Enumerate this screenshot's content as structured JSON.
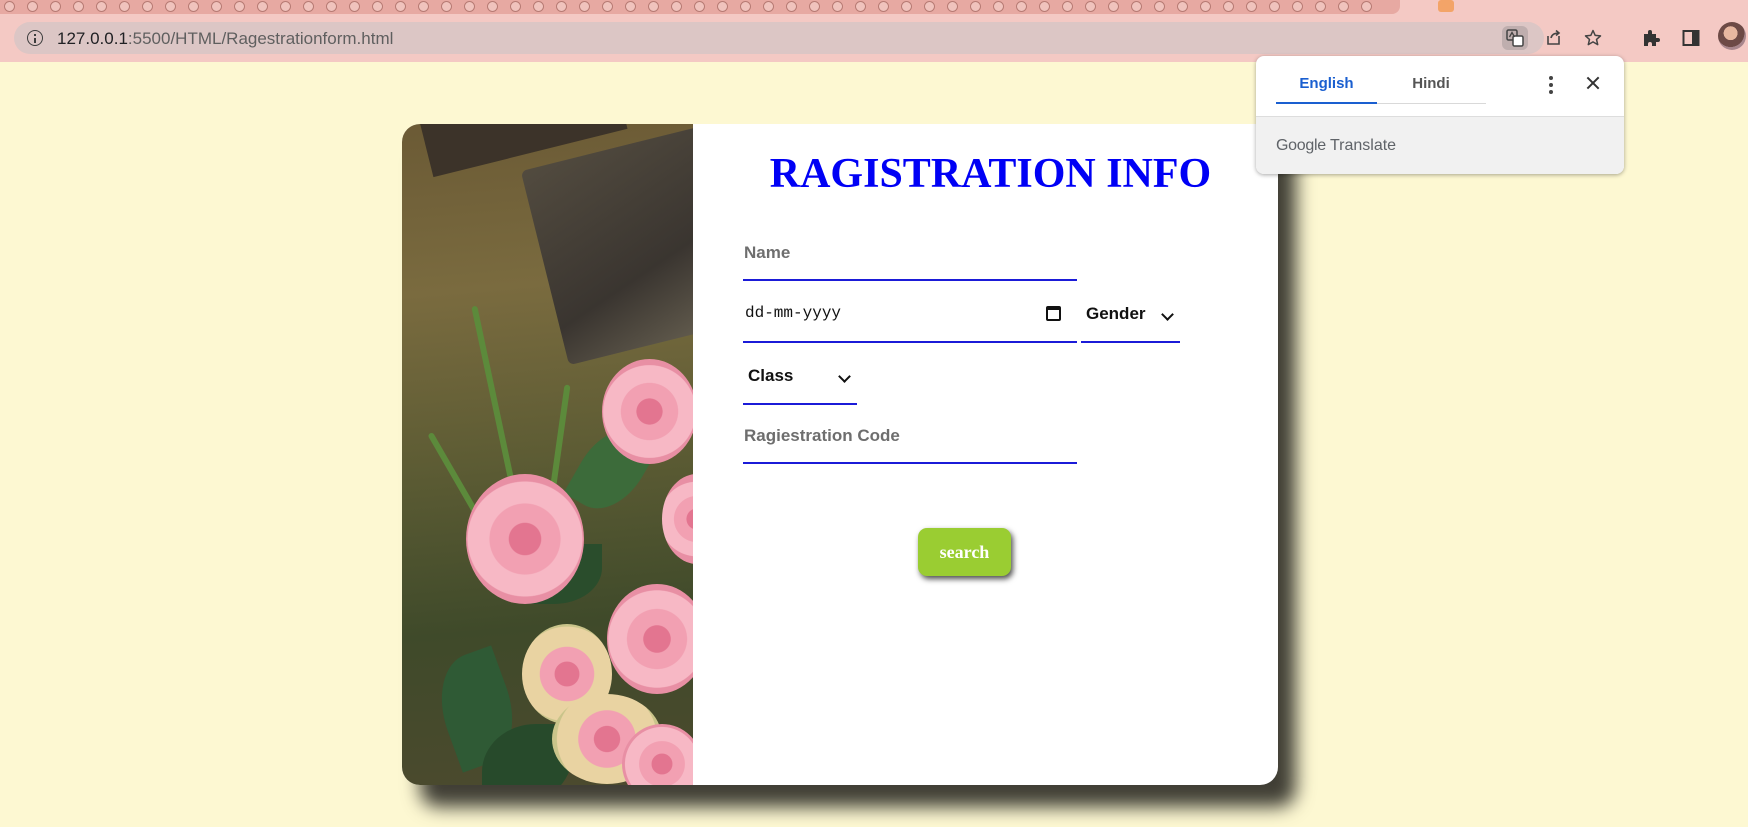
{
  "browser": {
    "url_host": "127.0.0.1",
    "url_path": ":5500/HTML/Ragestrationform.html"
  },
  "translate_popup": {
    "tabs": [
      "English",
      "Hindi"
    ],
    "active_tab": "English",
    "brand_google": "Google",
    "brand_translate": "Translate"
  },
  "form": {
    "title": "RAGISTRATION INFO",
    "name_placeholder": "Name",
    "date_placeholder": "dd-mm-yyyy",
    "gender_selected": "Gender",
    "class_selected": "Class",
    "code_placeholder": "Ragiestration Code",
    "search_label": "search"
  },
  "colors": {
    "page_bg": "#fdf8d2",
    "title": "#0000f5",
    "field_border": "#1b1bd8",
    "search_button": "#9acd32",
    "tab_active": "#1a5fd0"
  },
  "icons": [
    "info-icon",
    "translate-icon",
    "share-icon",
    "star-icon",
    "extensions-icon",
    "side-panel-icon",
    "calendar-icon",
    "chevron-down-icon",
    "more-vert-icon",
    "close-icon"
  ]
}
